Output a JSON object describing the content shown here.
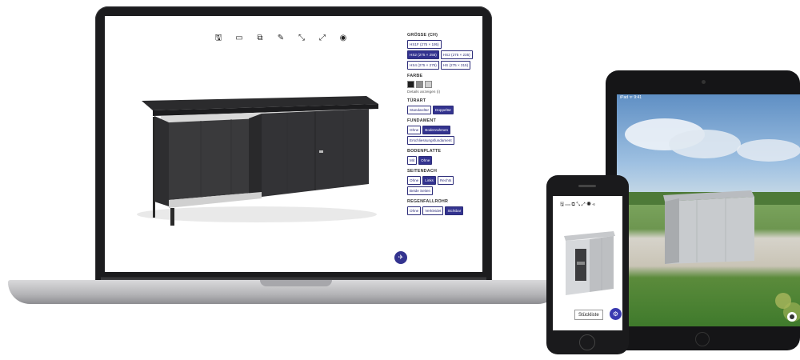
{
  "laptop": {
    "toolbar": [
      {
        "name": "save-icon",
        "glyph": "🖫"
      },
      {
        "name": "folder-icon",
        "glyph": "▭"
      },
      {
        "name": "copy-icon",
        "glyph": "⧉"
      },
      {
        "name": "edit-icon",
        "glyph": "✎"
      },
      {
        "name": "shrink-icon",
        "glyph": "⤡"
      },
      {
        "name": "expand-icon",
        "glyph": "⤢"
      },
      {
        "name": "view-icon",
        "glyph": "◉"
      }
    ],
    "panel": {
      "groesse": {
        "title": "GRÖSSE (CH)",
        "options": [
          "HS1F (275 × 195)",
          "HS2 (275 × 255)",
          "HS2 (275 × 235)",
          "HS4 (275 × 275)",
          "HS (275 × 315)"
        ],
        "selected": 1
      },
      "farbe": {
        "title": "FARBE",
        "swatches": [
          "#1e1e1e",
          "#8e8e8e",
          "#cfcfcf"
        ],
        "note": "Details anzeigen (i)"
      },
      "tuerart": {
        "title": "TÜRART",
        "options": [
          "Standardtür",
          "Doppeltür"
        ],
        "selected": 1
      },
      "fundament": {
        "title": "FUNDAMENT",
        "options": [
          "Ohne",
          "Bodenrahmen",
          "Erschliessungsfundament"
        ],
        "selected": 1
      },
      "bodenplatte": {
        "title": "BODENPLATTE",
        "options": [
          "Mit",
          "Ohne"
        ],
        "selected": 1
      },
      "seitendach": {
        "title": "SEITENDACH",
        "options": [
          "Ohne",
          "Links",
          "Rechts",
          "Beide Seiten"
        ],
        "selected": 1
      },
      "regenfallrohr": {
        "title": "REGENFALLROHR",
        "options": [
          "Ohne",
          "Verkleidet",
          "Sichtbar"
        ],
        "selected": 2
      }
    },
    "fab_glyph": "✈"
  },
  "tablet": {
    "status": "iPad  ᯤ  9:41"
  },
  "phone": {
    "toolbar_glyphs": "🖫 ▭ ⧉ ⤡ ⤢ ◉ ⋖",
    "list_button": "Stückliste",
    "fab_glyph": "⚙"
  }
}
